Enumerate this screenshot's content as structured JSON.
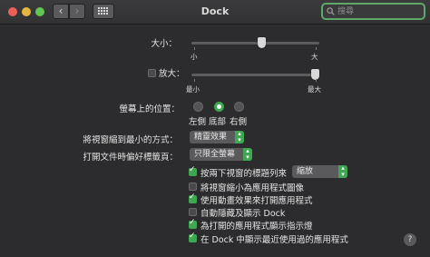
{
  "window": {
    "title": "Dock"
  },
  "toolbar": {
    "back_glyph": "‹",
    "forward_glyph": "›",
    "grid_icon": "grid-icon",
    "search_placeholder": "搜尋"
  },
  "size": {
    "label": "大小：",
    "min_label": "小",
    "max_label": "大",
    "value_fraction": 0.58
  },
  "magnification": {
    "label": "放大：",
    "checked": false,
    "min_label": "最小",
    "max_label": "最大",
    "value_fraction": 1.0
  },
  "position": {
    "label": "螢幕上的位置：",
    "options": [
      {
        "label": "左側",
        "selected": false
      },
      {
        "label": "底部",
        "selected": true
      },
      {
        "label": "右側",
        "selected": false
      }
    ]
  },
  "minimize_effect": {
    "label": "將視窗縮到最小的方式：",
    "value": "精靈效果"
  },
  "prefer_tabs": {
    "label": "打開文件時偏好標籤頁：",
    "value": "只限全螢幕"
  },
  "double_click": {
    "label": "按兩下視窗的標題列來",
    "checked": true,
    "value": "縮放"
  },
  "checkboxes": [
    {
      "label": "將視窗縮小為應用程式圖像",
      "checked": false
    },
    {
      "label": "使用動畫效果來打開應用程式",
      "checked": true
    },
    {
      "label": "自動隱藏及顯示 Dock",
      "checked": false
    },
    {
      "label": "為打開的應用程式顯示指示燈",
      "checked": true
    },
    {
      "label": "在 Dock 中顯示最近使用過的應用程式",
      "checked": true
    }
  ],
  "help": {
    "label": "?"
  },
  "colors": {
    "accent": "#3fa651",
    "close": "#ec5f57",
    "minimize": "#e6b73f",
    "zoom": "#5fc553"
  }
}
